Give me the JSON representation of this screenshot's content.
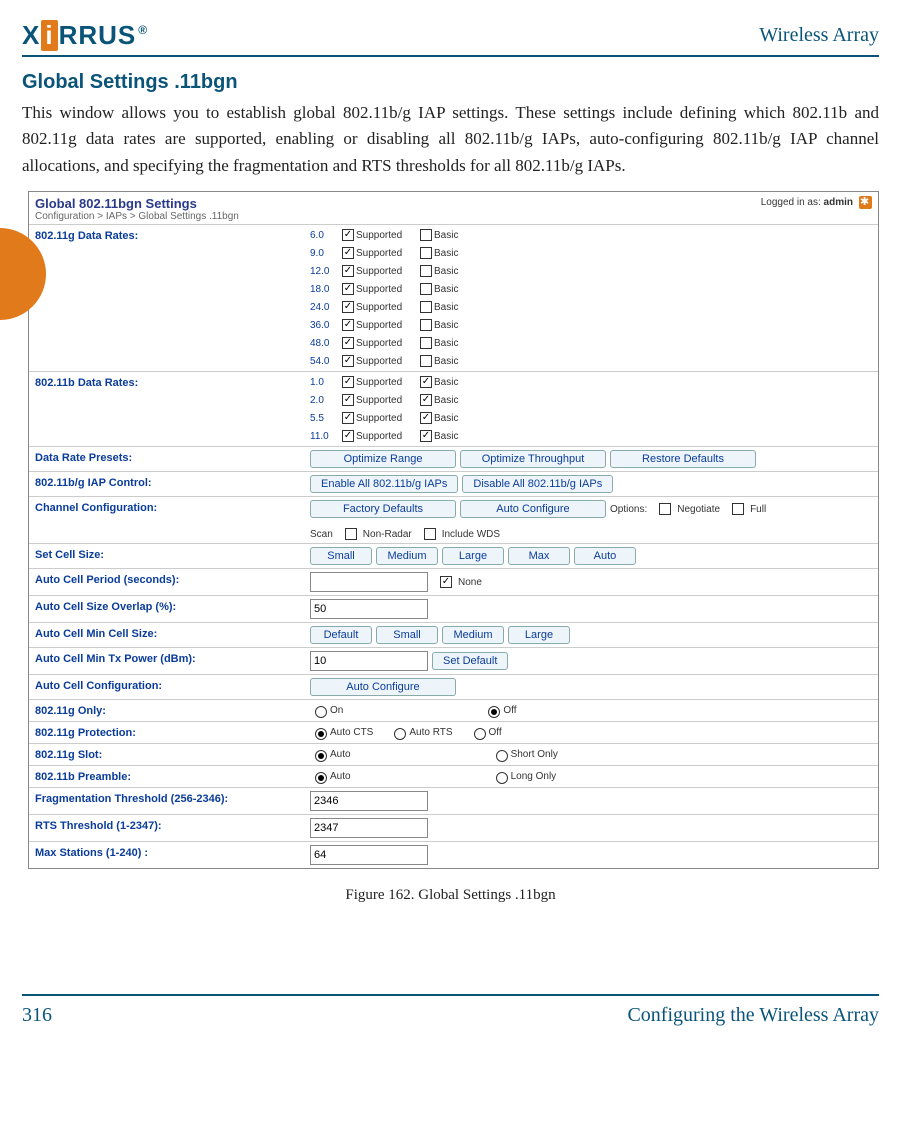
{
  "header": {
    "brand_pre": "X",
    "brand_i": "i",
    "brand_post": "RRUS",
    "reg": "®",
    "right": "Wireless Array"
  },
  "title": "Global Settings .11bgn",
  "intro": "This window allows you to establish global 802.11b/g IAP settings. These settings include defining which 802.11b and 802.11g data rates are supported, enabling or disabling all 802.11b/g IAPs, auto-configuring 802.11b/g IAP channel allocations, and specifying the fragmentation and RTS thresholds for all 802.11b/g IAPs.",
  "shot": {
    "panel_title": "Global 802.11bgn Settings",
    "breadcrumb": "Configuration > IAPs > Global Settings .11bgn",
    "logged_in": "Logged in as:",
    "admin": "admin",
    "labels": {
      "g_rates": "802.11g Data Rates:",
      "b_rates": "802.11b Data Rates:",
      "presets": "Data Rate Presets:",
      "iap_ctrl": "802.11b/g IAP Control:",
      "chan": "Channel Configuration:",
      "cell": "Set Cell Size:",
      "period": "Auto Cell Period (seconds):",
      "overlap": "Auto Cell Size Overlap (%):",
      "min_cell": "Auto Cell Min Cell Size:",
      "min_tx": "Auto Cell Min Tx Power (dBm):",
      "auto_conf": "Auto Cell Configuration:",
      "gonly": "802.11g Only:",
      "gprot": "802.11g Protection:",
      "gslot": "802.11g Slot:",
      "bpre": "802.11b Preamble:",
      "frag": "Fragmentation Threshold (256-2346):",
      "rts": "RTS Threshold (1-2347):",
      "maxsta": "Max Stations (1-240) :"
    },
    "supported": "Supported",
    "basic": "Basic",
    "g_rates": [
      {
        "n": "6.0",
        "s": true,
        "b": false
      },
      {
        "n": "9.0",
        "s": true,
        "b": false
      },
      {
        "n": "12.0",
        "s": true,
        "b": false
      },
      {
        "n": "18.0",
        "s": true,
        "b": false
      },
      {
        "n": "24.0",
        "s": true,
        "b": false
      },
      {
        "n": "36.0",
        "s": true,
        "b": false
      },
      {
        "n": "48.0",
        "s": true,
        "b": false
      },
      {
        "n": "54.0",
        "s": true,
        "b": false
      }
    ],
    "b_rates": [
      {
        "n": "1.0",
        "s": true,
        "b": true
      },
      {
        "n": "2.0",
        "s": true,
        "b": true
      },
      {
        "n": "5.5",
        "s": true,
        "b": true
      },
      {
        "n": "11.0",
        "s": true,
        "b": true
      }
    ],
    "btns": {
      "opt_range": "Optimize Range",
      "opt_thru": "Optimize Throughput",
      "restore": "Restore Defaults",
      "enable_all": "Enable All 802.11b/g IAPs",
      "disable_all": "Disable All 802.11b/g IAPs",
      "factory": "Factory Defaults",
      "auto_cfg": "Auto Configure",
      "small": "Small",
      "medium": "Medium",
      "large": "Large",
      "max": "Max",
      "auto": "Auto",
      "default": "Default",
      "set_default": "Set Default",
      "ac": "Auto Configure"
    },
    "chan_opts": {
      "options": "Options:",
      "negotiate": "Negotiate",
      "full": "Full",
      "scan": "Scan",
      "nonradar": "Non-Radar",
      "include_wds": "Include WDS"
    },
    "period": {
      "none": "None"
    },
    "overlap_val": "50",
    "min_tx_val": "10",
    "radios": {
      "on": "On",
      "off": "Off",
      "auto_cts": "Auto CTS",
      "auto_rts": "Auto RTS",
      "auto": "Auto",
      "short": "Short Only",
      "long": "Long Only"
    },
    "frag_val": "2346",
    "rts_val": "2347",
    "max_val": "64"
  },
  "caption": "Figure 162. Global Settings .11bgn",
  "footer": {
    "page": "316",
    "text": "Configuring the Wireless Array"
  }
}
